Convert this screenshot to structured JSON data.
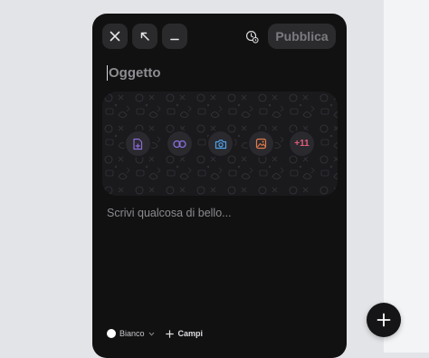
{
  "toolbar": {
    "close_icon": "close-icon",
    "expand_icon": "arrow-up-left-icon",
    "minimize_icon": "minimize-icon",
    "schedule_icon": "clock-schedule-icon",
    "publish_label": "Pubblica"
  },
  "composer": {
    "subject_placeholder": "Oggetto",
    "body_placeholder": "Scrivi qualcosa di bello...",
    "media_buttons": [
      {
        "icon": "file-add-icon",
        "color": "#8d6bd6"
      },
      {
        "icon": "link-icon",
        "color": "#8a6fe0"
      },
      {
        "icon": "camera-icon",
        "color": "#4fa0e8"
      },
      {
        "icon": "image-icon",
        "color": "#e07a4a"
      },
      {
        "label": "+11",
        "color": "#e25c7a"
      }
    ]
  },
  "footer": {
    "theme_label": "Bianco",
    "theme_color": "#ffffff",
    "fields_label": "Campi"
  },
  "fab": {
    "icon": "plus-icon"
  }
}
